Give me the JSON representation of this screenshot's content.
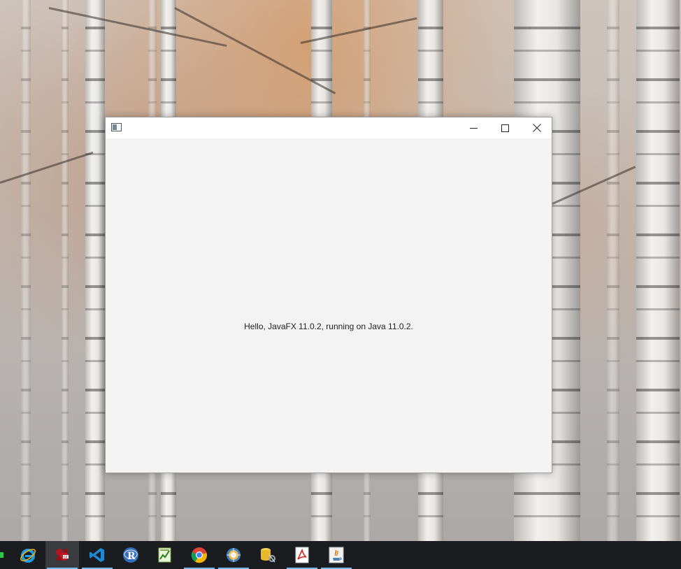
{
  "window": {
    "title": "",
    "buttons": {
      "minimize": "minimize-icon",
      "maximize": "maximize-icon",
      "close": "close-icon"
    },
    "content_text": "Hello, JavaFX 11.0.2, running on Java 11.0.2."
  },
  "taskbar": {
    "items": [
      {
        "name": "internet-explorer",
        "icon": "internet-explorer-icon",
        "running": false
      },
      {
        "name": "scratch-app",
        "icon": "red-bug-icon",
        "running": true,
        "active": true
      },
      {
        "name": "visual-studio-code",
        "icon": "vscode-icon",
        "running": true
      },
      {
        "name": "r",
        "icon": "r-icon",
        "running": false
      },
      {
        "name": "notepad-plus-plus",
        "icon": "notepad-icon",
        "running": false
      },
      {
        "name": "google-chrome",
        "icon": "chrome-icon",
        "running": true
      },
      {
        "name": "eclipse",
        "icon": "eclipse-icon",
        "running": true
      },
      {
        "name": "database-tool",
        "icon": "database-icon",
        "running": false
      },
      {
        "name": "acrobat-reader",
        "icon": "pdf-icon",
        "running": true
      },
      {
        "name": "java-app",
        "icon": "java-icon",
        "running": true
      }
    ]
  },
  "colors": {
    "taskbar": "#1b1c1f",
    "running_indicator": "#76b9ed",
    "window_background": "#f3f3f3"
  }
}
